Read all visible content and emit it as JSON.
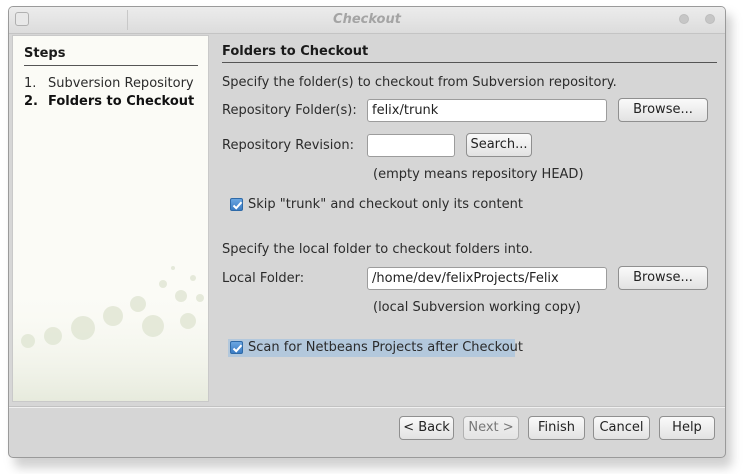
{
  "window": {
    "title": "Checkout"
  },
  "steps": {
    "heading": "Steps",
    "items": [
      {
        "num": "1.",
        "label": "Subversion Repository",
        "active": false
      },
      {
        "num": "2.",
        "label": "Folders to Checkout",
        "active": true
      }
    ]
  },
  "panel": {
    "title": "Folders to Checkout",
    "intro": "Specify the folder(s) to checkout from Subversion repository.",
    "repo_folder": {
      "label": "Repository Folder(s):",
      "value": "felix/trunk",
      "browse_label": "Browse..."
    },
    "repo_revision": {
      "label": "Repository Revision:",
      "value": "",
      "search_label": "Search...",
      "hint": "(empty means repository HEAD)"
    },
    "skip_trunk": {
      "label": "Skip \"trunk\" and checkout only its content",
      "checked": true
    },
    "local_intro": "Specify the local folder to checkout folders into.",
    "local_folder": {
      "label": "Local Folder:",
      "value": "/home/dev/felixProjects/Felix",
      "browse_label": "Browse...",
      "hint": "(local Subversion working copy)"
    },
    "scan": {
      "label": "Scan for Netbeans Projects after Checkout",
      "checked": true
    }
  },
  "footer": {
    "back": "< Back",
    "next": "Next >",
    "finish": "Finish",
    "cancel": "Cancel",
    "help": "Help"
  }
}
